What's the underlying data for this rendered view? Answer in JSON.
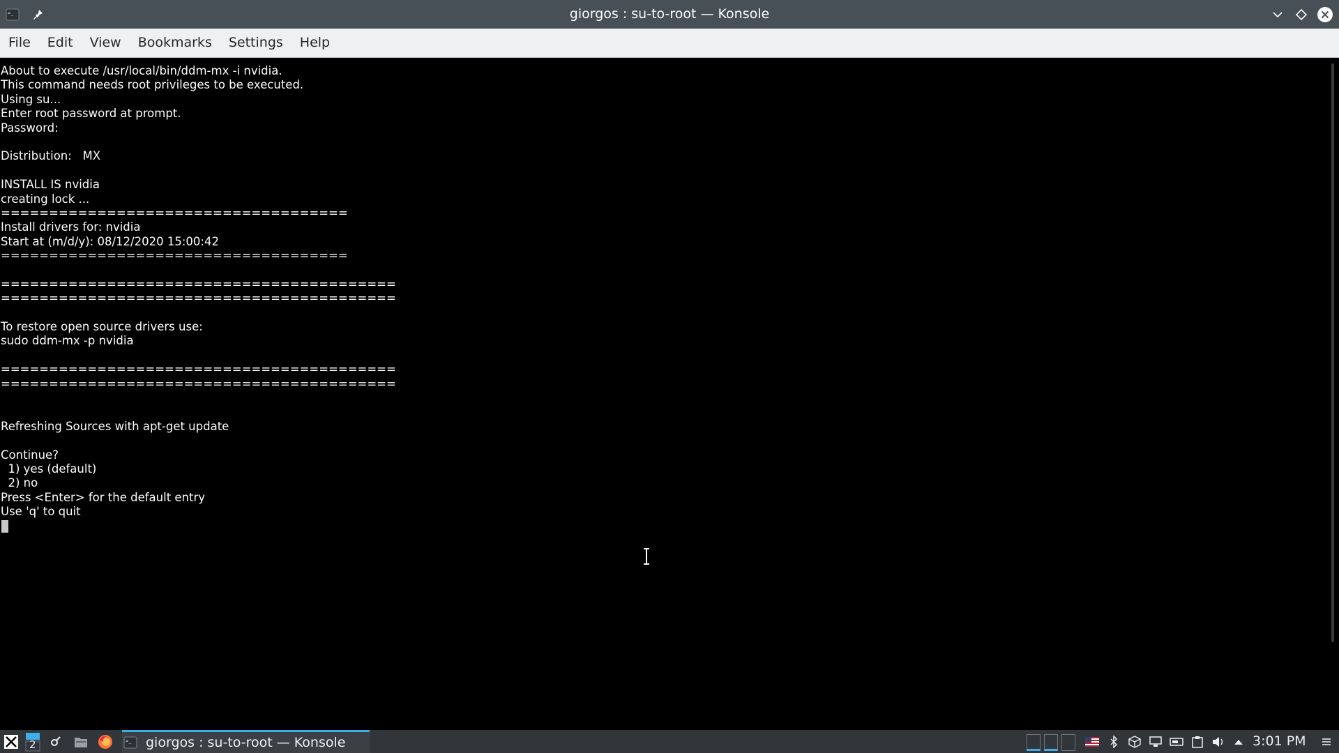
{
  "window": {
    "title": "giorgos : su-to-root — Konsole"
  },
  "menu": [
    "File",
    "Edit",
    "View",
    "Bookmarks",
    "Settings",
    "Help"
  ],
  "terminal": {
    "lines": [
      "About to execute /usr/local/bin/ddm-mx -i nvidia.",
      "This command needs root privileges to be executed.",
      "Using su...",
      "Enter root password at prompt.",
      "Password:",
      "",
      "Distribution:   MX",
      "",
      "INSTALL IS nvidia",
      "creating lock ...",
      "====================================",
      "Install drivers for: nvidia",
      "Start at (m/d/y): 08/12/2020 15:00:42",
      "====================================",
      "",
      "=========================================",
      "=========================================",
      "",
      "To restore open source drivers use:",
      "sudo ddm-mx -p nvidia",
      "",
      "=========================================",
      "=========================================",
      "",
      "",
      "Refreshing Sources with apt-get update",
      "",
      "Continue?",
      "  1) yes (default)",
      "  2) no",
      "Press <Enter> for the default entry",
      "Use 'q' to quit"
    ]
  },
  "taskbar": {
    "desktop_number": "2",
    "task_label": "giorgos : su-to-root — Konsole",
    "clock": "3:01 PM"
  },
  "colors": {
    "titlebar": "#475057",
    "menubar": "#eff0f1",
    "terminal_bg": "#000000",
    "terminal_fg": "#fcfcfc",
    "taskbar": "#31363b",
    "accent": "#3daee9",
    "close_button": "#ffffff"
  }
}
